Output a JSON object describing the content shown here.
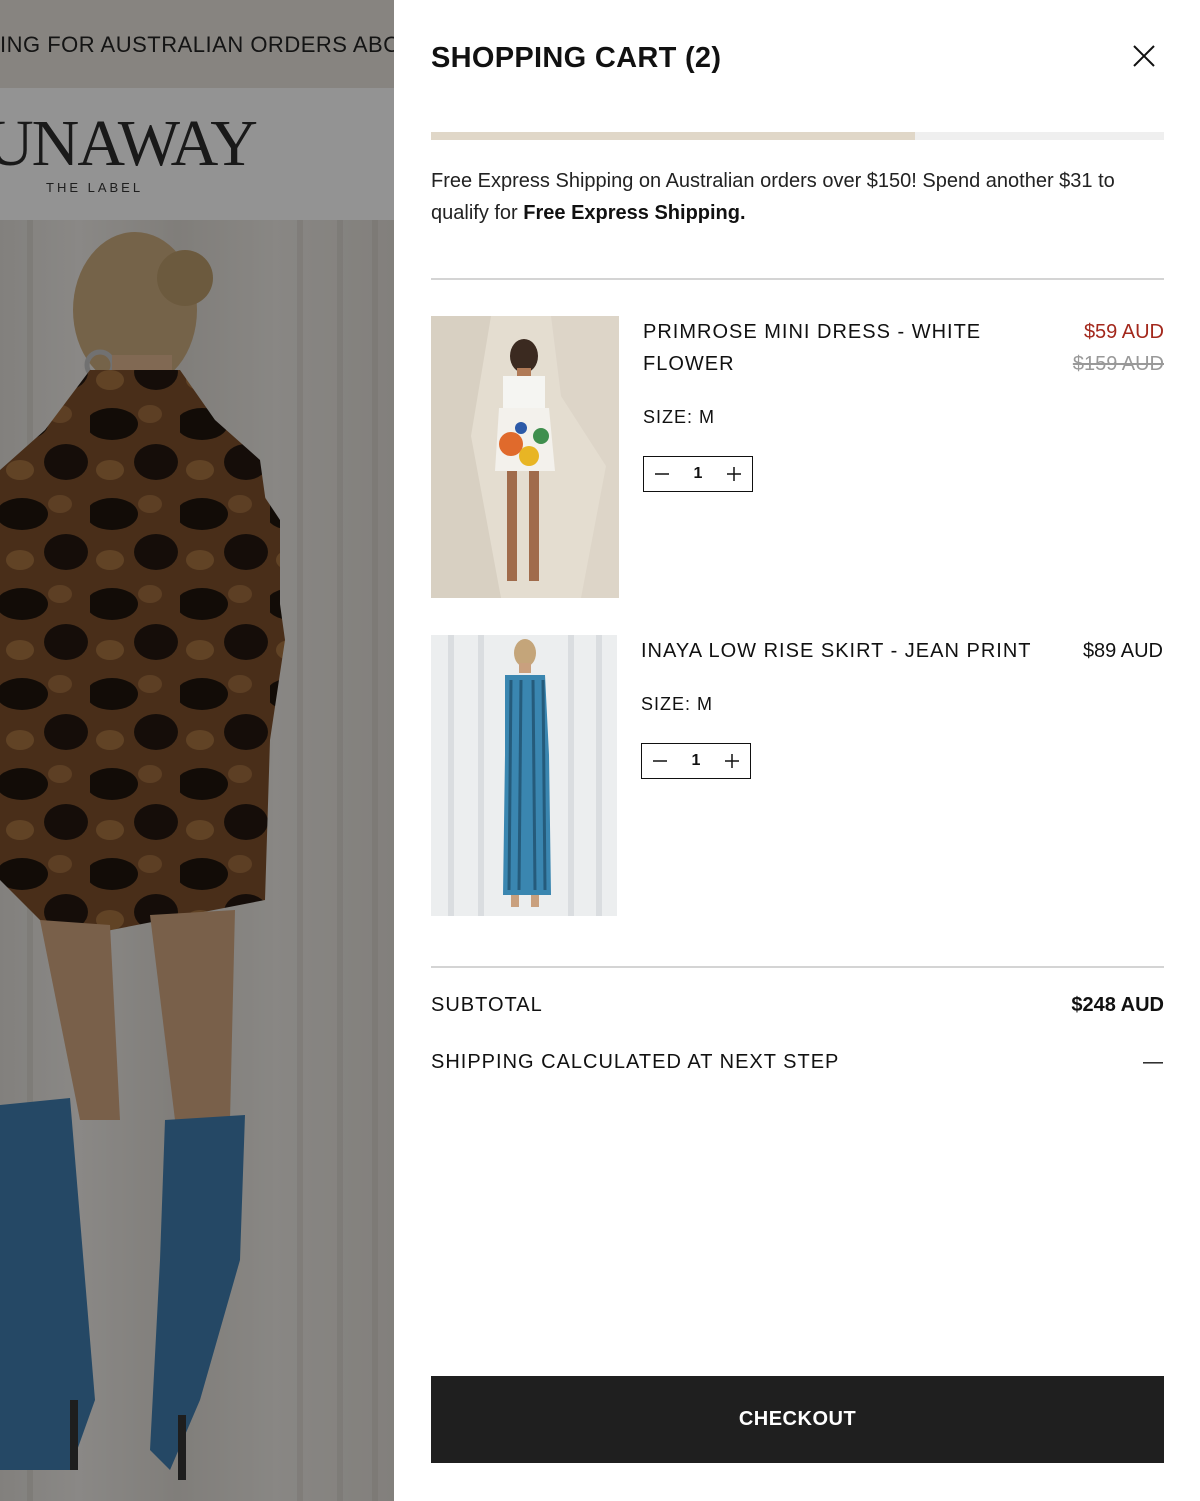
{
  "background": {
    "announcement": "ING FOR AUSTRALIAN ORDERS ABO",
    "logo_text": "UNAWAY",
    "logo_subtitle": "THE LABEL"
  },
  "cart": {
    "title": "SHOPPING CART (2)",
    "free_shipping_progress": 0.66,
    "shipping_message": "Free Express Shipping on Australian orders over $150! Spend another $31 to qualify for ",
    "shipping_message_bold": "Free Express Shipping.",
    "items": [
      {
        "name": "PRIMROSE MINI DRESS - WHITE FLOWER",
        "price": "$59 AUD",
        "compare_price": "$159 AUD",
        "size": "SIZE: M",
        "quantity": "1"
      },
      {
        "name": "INAYA LOW RISE SKIRT - JEAN PRINT",
        "price": "$89 AUD",
        "size": "SIZE: M",
        "quantity": "1"
      }
    ],
    "subtotal_label": "SUBTOTAL",
    "subtotal_value": "$248 AUD",
    "shipping_label": "SHIPPING CALCULATED AT NEXT STEP",
    "shipping_value": "—",
    "checkout_label": "CHECKOUT"
  },
  "colors": {
    "sale_price": "#a3281c",
    "progress_fill": "#e0d7c8",
    "checkout_bg": "#1f1f1f"
  },
  "icons": [
    "close-icon",
    "minus-icon",
    "plus-icon"
  ]
}
